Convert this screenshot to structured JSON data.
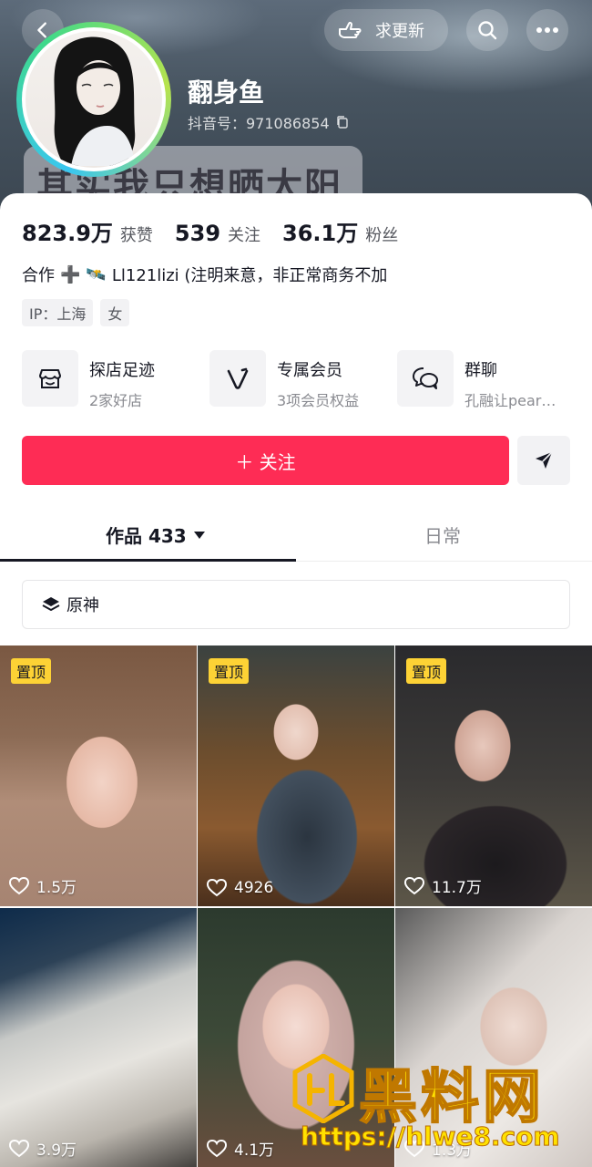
{
  "header": {
    "update_label": "求更新",
    "nickname": "翻身鱼",
    "douyin_id": "抖音号：971086854",
    "banner_text": "其实我只想晒太阳"
  },
  "stats": [
    {
      "num": "823.9万",
      "label": "获赞"
    },
    {
      "num": "539",
      "label": "关注"
    },
    {
      "num": "36.1万",
      "label": "粉丝"
    }
  ],
  "bio": {
    "prefix": "合作",
    "plus": "➕",
    "emoji": "🛰️",
    "text": "Ll121lizi (注明来意，非正常商务不加"
  },
  "tags": [
    "IP：上海",
    "女"
  ],
  "services": [
    {
      "title": "探店足迹",
      "sub": "2家好店",
      "icon": "shop-icon"
    },
    {
      "title": "专属会员",
      "sub": "3项会员权益",
      "icon": "vip-v-icon"
    },
    {
      "title": "群聊",
      "sub": "孔融让pear…",
      "icon": "chat-bubbles-icon"
    }
  ],
  "follow_label": "＋ 关注",
  "tabs": {
    "works": "作品 433",
    "daily": "日常"
  },
  "filter_label": "原神",
  "videos": [
    {
      "pinned": "置顶",
      "likes": "1.5万"
    },
    {
      "pinned": "置顶",
      "likes": "4926"
    },
    {
      "pinned": "置顶",
      "likes": "11.7万"
    },
    {
      "pinned": "",
      "likes": "3.9万"
    },
    {
      "pinned": "",
      "likes": "4.1万"
    },
    {
      "pinned": "",
      "likes": "1.3万"
    }
  ],
  "watermark": {
    "title": "黑料网",
    "url": "https://hlwe8.com"
  },
  "colors": {
    "accent": "#fe2c55",
    "pin_badge": "#fdd235"
  }
}
